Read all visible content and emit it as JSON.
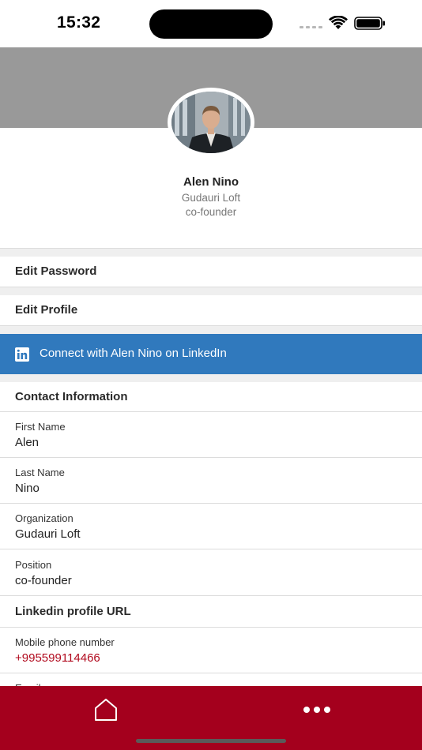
{
  "status_bar": {
    "time": "15:32"
  },
  "profile": {
    "name": "Alen Nino",
    "organization": "Gudauri Loft",
    "position": "co-founder",
    "avatar_icon": "profile-photo"
  },
  "menu": {
    "edit_password": "Edit Password",
    "edit_profile": "Edit Profile"
  },
  "linkedin": {
    "label": "Connect with Alen Nino on LinkedIn",
    "icon": "linkedin-icon",
    "color": "#3079bd"
  },
  "contact": {
    "title": "Contact Information",
    "fields": [
      {
        "label": "First Name",
        "value": "Alen"
      },
      {
        "label": "Last Name",
        "value": "Nino"
      },
      {
        "label": "Organization",
        "value": "Gudauri Loft"
      },
      {
        "label": "Position",
        "value": "co-founder"
      }
    ],
    "linkedin_url_label": "Linkedin profile URL",
    "mobile": {
      "label": "Mobile phone number",
      "value": "+995599114466"
    },
    "email_label": "Email"
  },
  "tabbar": {
    "color": "#a4001d",
    "home_icon": "home-icon",
    "more_icon": "more-icon"
  }
}
